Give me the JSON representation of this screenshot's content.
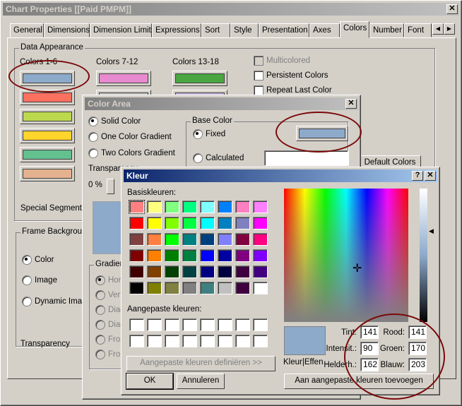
{
  "main": {
    "title": "Chart Properties [[Paid PMPM]]",
    "tabs": [
      "General",
      "Dimensions",
      "Dimension Limits",
      "Expressions",
      "Sort",
      "Style",
      "Presentation",
      "Axes",
      "Colors",
      "Number",
      "Font"
    ],
    "active_tab": "Colors",
    "data_appearance": "Data Appearance",
    "col_labels": [
      "Colors 1-6",
      "Colors 7-12",
      "Colors 13-18"
    ],
    "colors_1_6": [
      "#8daacb",
      "#fc7060",
      "#bcd94e",
      "#ffd42b",
      "#63c08f",
      "#e4b28f"
    ],
    "colors_7_12": [
      "#e88ad0",
      "#c8c8c8"
    ],
    "colors_13_18": [
      "#4aa642",
      "#c8b8e0"
    ],
    "multicolored": "Multicolored",
    "persistent": "Persistent Colors",
    "repeat": "Repeat Last Color",
    "default_colors": "Default Colors",
    "special_segments": "Special Segments",
    "frame_bg": "Frame Background",
    "frame_color": "Color",
    "frame_image": "Image",
    "frame_dynamic": "Dynamic Image",
    "transparency": "Transparency"
  },
  "color_area": {
    "title": "Color Area",
    "solid": "Solid Color",
    "one_grad": "One Color Gradient",
    "two_grad": "Two Colors Gradient",
    "transparency": "Transparency",
    "transparency_value": "0 %",
    "base_color": "Base Color",
    "fixed": "Fixed",
    "calculated": "Calculated",
    "base_color_value": "#8daacb",
    "gradient": "Gradient",
    "gradient_options": [
      "Horizontal",
      "Vertical",
      "Diagonal",
      "Diagonal",
      "From",
      "From"
    ]
  },
  "kleur": {
    "title": "Kleur",
    "help": "?",
    "basic_label": "Basiskleuren:",
    "basic_colors": [
      "#ff8080",
      "#ffff80",
      "#80ff80",
      "#00ff80",
      "#80ffff",
      "#0080ff",
      "#ff80c0",
      "#ff80ff",
      "#ff0000",
      "#ffff00",
      "#80ff00",
      "#00ff40",
      "#00ffff",
      "#0080c0",
      "#8080c0",
      "#ff00ff",
      "#804040",
      "#ff8040",
      "#00ff00",
      "#008080",
      "#004080",
      "#8080ff",
      "#800040",
      "#ff0080",
      "#800000",
      "#ff8000",
      "#008000",
      "#008040",
      "#0000ff",
      "#0000a0",
      "#800080",
      "#8000ff",
      "#400000",
      "#804000",
      "#004000",
      "#004040",
      "#000080",
      "#000040",
      "#400040",
      "#400080",
      "#000000",
      "#808000",
      "#808040",
      "#808080",
      "#408080",
      "#c0c0c0",
      "#400040",
      "#ffffff"
    ],
    "custom_label": "Aangepaste kleuren:",
    "define_btn": "Aangepaste kleuren definiëren >>",
    "ok": "OK",
    "cancel": "Annuleren",
    "preview_label": "Kleur|Effen",
    "preview_color": "#8daacb",
    "tint_label": "Tint:",
    "tint": "141",
    "sat_label": "Intensit.:",
    "sat": "90",
    "lum_label": "Helderh.:",
    "lum": "162",
    "red_label": "Rood:",
    "red": "141",
    "green_label": "Groen:",
    "green": "170",
    "blue_label": "Blauw:",
    "blue": "203",
    "add_btn": "Aan aangepaste kleuren toevoegen"
  }
}
